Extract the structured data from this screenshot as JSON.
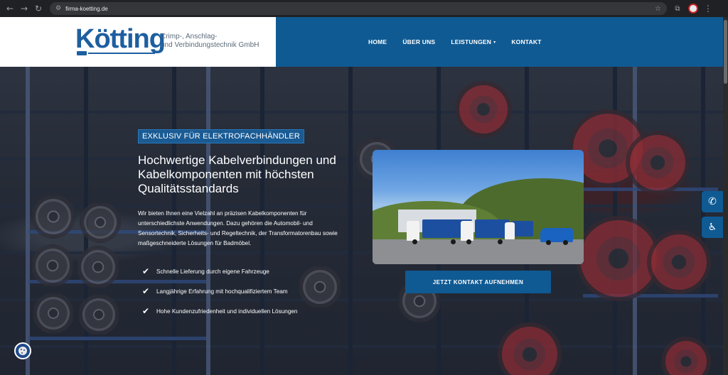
{
  "browser": {
    "url": "firma-koetting.de",
    "back_icon": "arrow-left-icon",
    "forward_icon": "arrow-right-icon",
    "reload_icon": "reload-icon"
  },
  "logo": {
    "wordmark": "Kötting",
    "subtitle_line1": "Crimp-, Anschlag-",
    "subtitle_line2": "und Verbindungstechnik GmbH"
  },
  "nav": {
    "items": [
      {
        "label": "HOME"
      },
      {
        "label": "ÜBER UNS"
      },
      {
        "label": "LEISTUNGEN",
        "has_dropdown": true
      },
      {
        "label": "KONTAKT"
      }
    ]
  },
  "hero": {
    "eyebrow": "EXKLUSIV FÜR ELEKTROFACHHÄNDLER",
    "title": "Hochwertige Kabelverbindungen und Kabelkomponenten mit höchsten Qualitätsstandards",
    "text": "Wir bieten Ihnen eine Vielzahl an präzisen Kabelkomponenten für unterschiedlichste Anwendungen. Dazu gehören die Automobil- und Sensortechnik, Sicherheits- und Regeltechnik, der Transformatorenbau sowie maßgeschneiderte Lösungen für Badmöbel.",
    "bullets": [
      "Schnelle Lieferung durch eigene Fahrzeuge",
      "Langjährige Erfahrung mit hochqualifiziertem Team",
      "Hohe Kundenzufriedenheit und individuellen Lösungen"
    ],
    "cta_label": "JETZT KONTAKT AUFNEHMEN"
  },
  "side_widgets": {
    "phone_icon": "phone-icon",
    "accessibility_icon": "accessibility-icon",
    "cookie_icon": "cookie-icon"
  },
  "colors": {
    "brand_blue": "#0f5a93",
    "logo_blue": "#1d5fa0"
  }
}
